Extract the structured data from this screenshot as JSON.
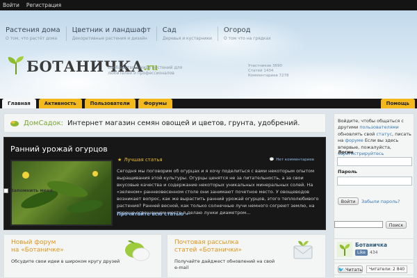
{
  "topbar": {
    "login": "Войти",
    "register": "Регистрация"
  },
  "categories": [
    {
      "title": "Растения дома",
      "sub": "О том, что растёт дома"
    },
    {
      "title": "Цветник и ландшафт",
      "sub": "Декоративные растения и дизайн"
    },
    {
      "title": "Сад",
      "sub": "Деревья и кустарники"
    },
    {
      "title": "Огород",
      "sub": "О том что на грядках"
    }
  ],
  "logo": {
    "text": "БОТАНИЧКА",
    "tld": ".ru"
  },
  "tagline": "Сообщество о мире растений для любителей и профессионалов",
  "stats": {
    "members": "Участников 3690",
    "articles": "Статей 1434",
    "comments": "Комментариев 7278"
  },
  "nav": {
    "tabs": [
      "Главная",
      "Активность",
      "Пользователи",
      "Форумы"
    ],
    "help": "Помощь"
  },
  "promo": {
    "brand": "ДомСадок:",
    "text": "Интернет магазин семян овощей и цветов, грунта, удобрений."
  },
  "feature": {
    "title": "Ранний урожай огурцов",
    "badge": "Лучшая статья",
    "comments": "Нет комментариев",
    "excerpt": "Сегодня мы поговорим об огурцах и я хочу поделиться с вами некоторым опытом выращивания этой культуры. Огурцы ценятся не за питательность, а за свои вкусовые качества и содержание некоторых уникальных минеральных солей. На «зеленом» раннеовесенном столе они занимают почетное место. У овощеводов возникает вопрос, как же вырастить ранний урожай огурцов, этого теплолюбивого растения? Ранней весной, как только солнечные лучи немного согреют землю, на хорошо освещенном месте я делаю лунки диаметром...",
    "read_more": "Прочитайте всю статью »"
  },
  "forum_box": {
    "title": "Новый форум\nна «Ботаничке»",
    "text": "Обсудите свои идеи в широком кругу друзей"
  },
  "mail_box": {
    "title": "Почтовая рассылка\nстатей «Ботанички»",
    "text": "Получайте дайджест обновлений на свой e-mail"
  },
  "sidebar": {
    "intro_a": "Войдите, чтобы общаться с другими",
    "link_users": "пользователями",
    "intro_b": "обновлять свой",
    "link_status": "статус",
    "intro_c": ", писать на",
    "link_forum": "форуме",
    "intro_d": "Если вы здесь впервые, пожалуйста,",
    "link_register": "зарегистрируйтесь",
    "login_label": "Логин",
    "password_label": "Пароль",
    "remember": "Запомнить меня",
    "login_btn": "Войти",
    "forgot": "Забыли пароль?",
    "search_btn": "Поиск"
  },
  "vk": {
    "name": "Ботаничка",
    "like": "Like",
    "count": "434"
  },
  "twitter": {
    "btn": "Читать",
    "readers": "Читатели: 2 840"
  }
}
